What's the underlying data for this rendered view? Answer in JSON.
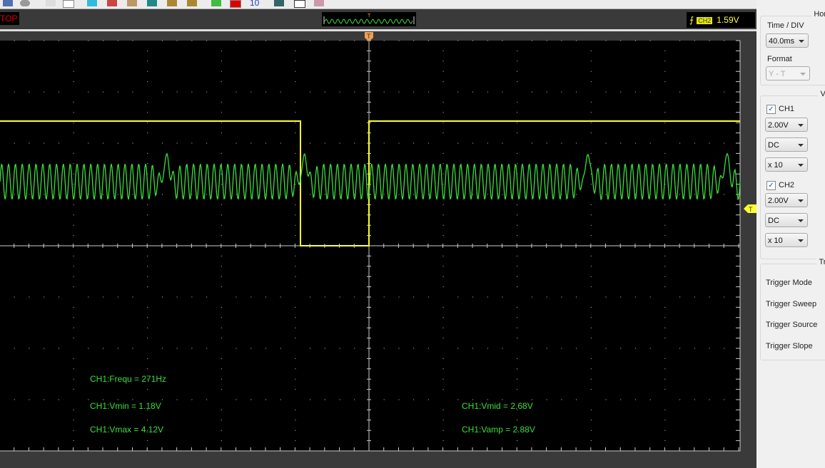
{
  "status": {
    "run_state": "TOP",
    "trigger_channel": "CH2",
    "trigger_level": "1.59V",
    "trigger_marker": "T"
  },
  "toolbar": {
    "counter": "10"
  },
  "measurements": {
    "ch1_freq": "CH1:Frequ = 271Hz",
    "ch1_vmin": "CH1:Vmin = 1.18V",
    "ch1_vmax": "CH1:Vmax = 4.12V",
    "ch1_vmid": "CH1:Vmid = 2.68V",
    "ch1_vamp": "CH1:Vamp = 2.88V"
  },
  "horizontal": {
    "title": "Horiz",
    "time_div_label": "Time / DIV",
    "time_div": "40.0ms",
    "format_label": "Format",
    "format": "Y - T"
  },
  "vertical": {
    "title": "Ver",
    "ch1": {
      "label": "CH1",
      "checked": true,
      "volts": "2.00V",
      "coupling": "DC",
      "probe": "x 10"
    },
    "ch2": {
      "label": "CH2",
      "checked": true,
      "volts": "2.00V",
      "coupling": "DC",
      "probe": "x 10"
    }
  },
  "trigger": {
    "title": "Trig",
    "items": [
      "Trigger Mode",
      "Trigger Sweep",
      "Trigger Source",
      "Trigger Slope"
    ]
  },
  "colors": {
    "ch1": "#3adf3a",
    "ch2": "#ffff30",
    "trigger_marker": "#f0a050"
  }
}
